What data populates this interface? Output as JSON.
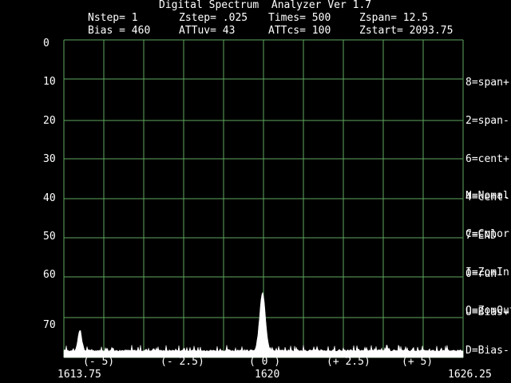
{
  "header": {
    "title": "Digital Spectrum  Analyzer Ver 1.7",
    "row1": [
      {
        "key": "nstep",
        "text": "Nstep= 1"
      },
      {
        "key": "zstep",
        "text": "Zstep= .025"
      },
      {
        "key": "times",
        "text": "Times= 500"
      },
      {
        "key": "zspan",
        "text": "Zspan= 12.5"
      }
    ],
    "row2": [
      {
        "key": "bias",
        "text": "Bias = 460"
      },
      {
        "key": "attuv",
        "text": "ATTuv= 43"
      },
      {
        "key": "attcs",
        "text": "ATTcs= 100"
      },
      {
        "key": "zstart",
        "text": "Zstart= 2093.75"
      }
    ]
  },
  "y_axis_labels": [
    "0",
    "10",
    "20",
    "30",
    "40",
    "50",
    "60",
    "70"
  ],
  "x_offset_labels": [
    "(- 5)",
    "(- 2.5)",
    "( 0 )",
    "(+ 2.5)",
    "(+ 5)"
  ],
  "x_bottom_labels": {
    "left": "1613.75",
    "center": "1620",
    "right": "1626.25"
  },
  "menu": {
    "group1": [
      "8=span+",
      "2=span-",
      "6=cent+",
      "4=cent-",
      "7=END",
      "0=run",
      "U=Bias+",
      "D=Bias-"
    ],
    "group2": [
      "N=Nomal",
      "C=Color",
      "I=ZomIn",
      "O=ZomOut"
    ]
  },
  "colors": {
    "grid": "#5fa85f",
    "background": "#000000",
    "trace": "#ffffff"
  },
  "chart_data": {
    "type": "area",
    "title": "Digital Spectrum  Analyzer Ver 1.7",
    "xlabel": "",
    "ylabel": "",
    "xlim": [
      1613.75,
      1626.25
    ],
    "ylim": [
      0,
      78
    ],
    "y_inverted_label_scale": true,
    "grid": true,
    "noise_floor": 76.5,
    "peaks": [
      {
        "x": 1614.25,
        "level": 71.5,
        "width": 0.12
      },
      {
        "x": 1619.97,
        "level": 62.5,
        "width": 0.18
      }
    ]
  }
}
